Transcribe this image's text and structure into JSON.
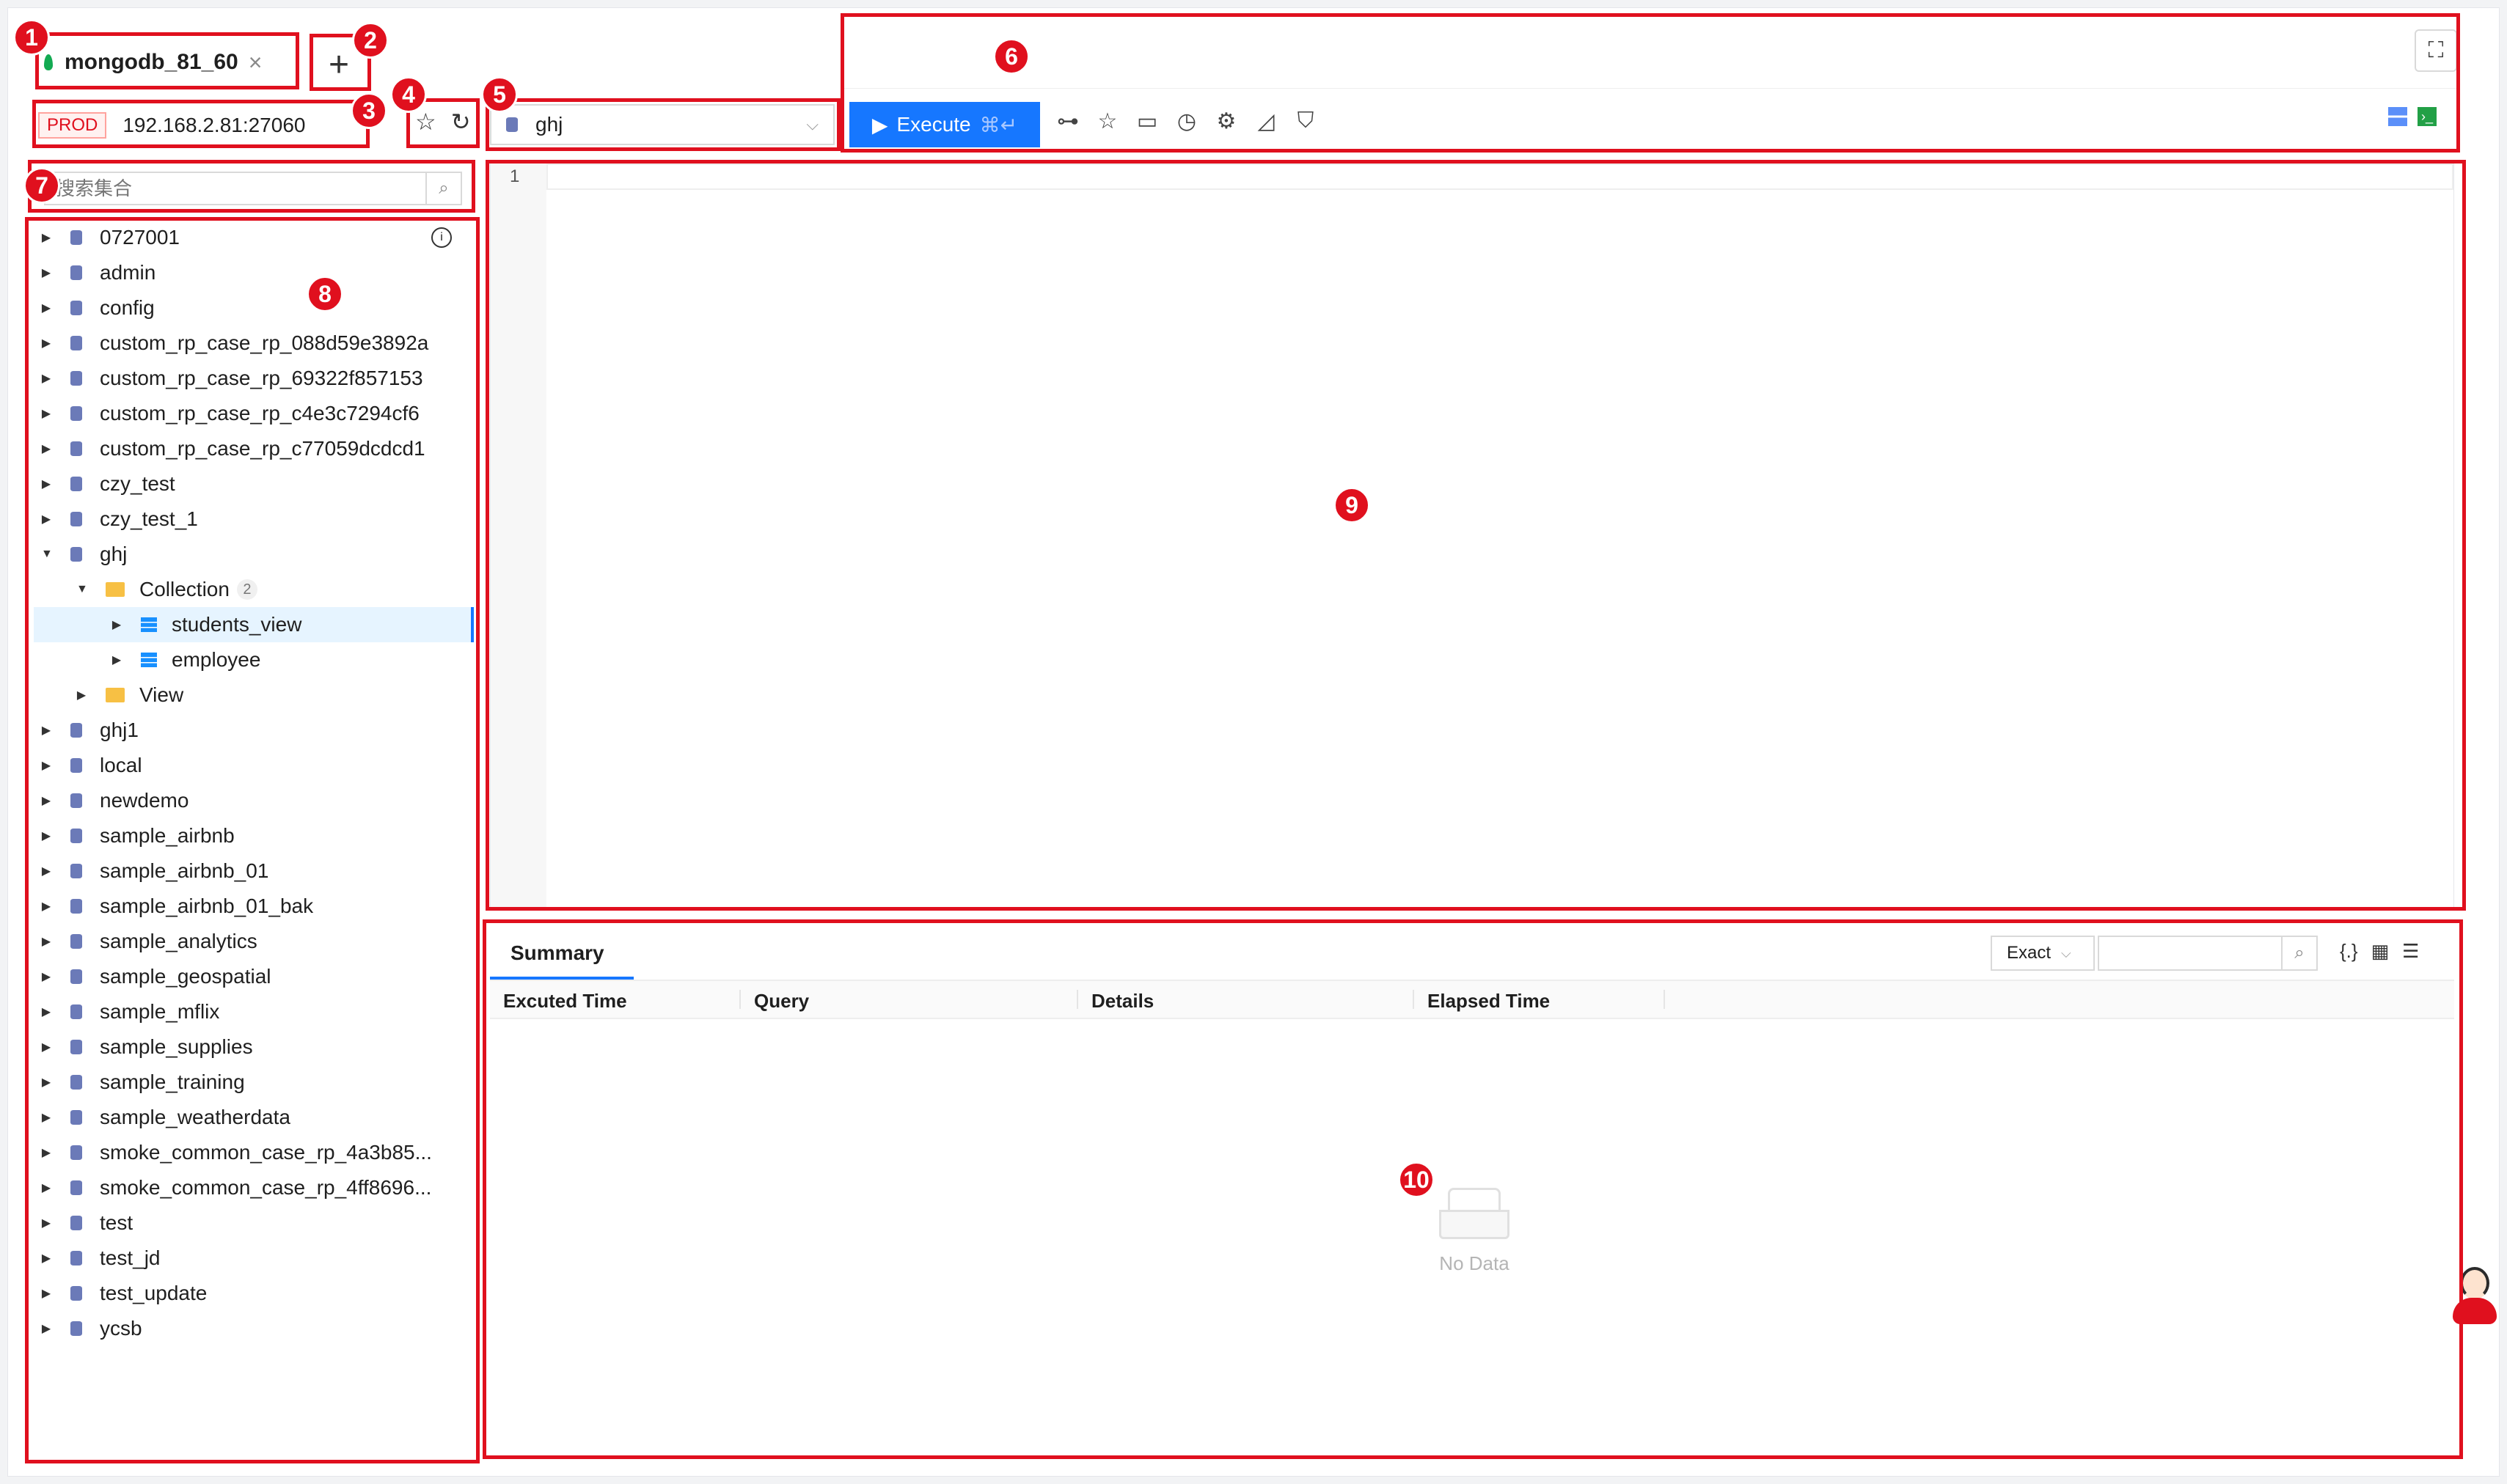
{
  "tab": {
    "label": "mongodb_81_60",
    "close": "×",
    "add": "+"
  },
  "connection": {
    "env": "PROD",
    "address": "192.168.2.81:27060"
  },
  "actions": {
    "star": "☆",
    "refresh": "↻"
  },
  "db_select": {
    "value": "ghj",
    "chevron": "⌵"
  },
  "toolbar": {
    "execute_label": "Execute",
    "execute_shortcut": "⌘↵",
    "fullscreen": "⛶",
    "icons": [
      "schema-icon",
      "favorite-icon",
      "folder-icon",
      "history-icon",
      "settings-icon",
      "chart-icon",
      "shield-icon"
    ]
  },
  "sidebar": {
    "search_placeholder": "搜索集合",
    "tree": [
      {
        "label": "0727001",
        "type": "db",
        "depth": 0,
        "expanded": false,
        "info": true
      },
      {
        "label": "admin",
        "type": "db",
        "depth": 0,
        "expanded": false
      },
      {
        "label": "config",
        "type": "db",
        "depth": 0,
        "expanded": false
      },
      {
        "label": "custom_rp_case_rp_088d59e3892a",
        "type": "db",
        "depth": 0,
        "expanded": false
      },
      {
        "label": "custom_rp_case_rp_69322f857153",
        "type": "db",
        "depth": 0,
        "expanded": false
      },
      {
        "label": "custom_rp_case_rp_c4e3c7294cf6",
        "type": "db",
        "depth": 0,
        "expanded": false
      },
      {
        "label": "custom_rp_case_rp_c77059dcdcd1",
        "type": "db",
        "depth": 0,
        "expanded": false
      },
      {
        "label": "czy_test",
        "type": "db",
        "depth": 0,
        "expanded": false
      },
      {
        "label": "czy_test_1",
        "type": "db",
        "depth": 0,
        "expanded": false
      },
      {
        "label": "ghj",
        "type": "db",
        "depth": 0,
        "expanded": true
      },
      {
        "label": "Collection",
        "type": "folder",
        "depth": 1,
        "expanded": true,
        "count": "2"
      },
      {
        "label": "students_view",
        "type": "collection",
        "depth": 2,
        "expanded": false,
        "selected": true
      },
      {
        "label": "employee",
        "type": "collection",
        "depth": 2,
        "expanded": false
      },
      {
        "label": "View",
        "type": "folder",
        "depth": 1,
        "expanded": false
      },
      {
        "label": "ghj1",
        "type": "db",
        "depth": 0,
        "expanded": false
      },
      {
        "label": "local",
        "type": "db",
        "depth": 0,
        "expanded": false
      },
      {
        "label": "newdemo",
        "type": "db",
        "depth": 0,
        "expanded": false
      },
      {
        "label": "sample_airbnb",
        "type": "db",
        "depth": 0,
        "expanded": false
      },
      {
        "label": "sample_airbnb_01",
        "type": "db",
        "depth": 0,
        "expanded": false
      },
      {
        "label": "sample_airbnb_01_bak",
        "type": "db",
        "depth": 0,
        "expanded": false
      },
      {
        "label": "sample_analytics",
        "type": "db",
        "depth": 0,
        "expanded": false
      },
      {
        "label": "sample_geospatial",
        "type": "db",
        "depth": 0,
        "expanded": false
      },
      {
        "label": "sample_mflix",
        "type": "db",
        "depth": 0,
        "expanded": false
      },
      {
        "label": "sample_supplies",
        "type": "db",
        "depth": 0,
        "expanded": false
      },
      {
        "label": "sample_training",
        "type": "db",
        "depth": 0,
        "expanded": false
      },
      {
        "label": "sample_weatherdata",
        "type": "db",
        "depth": 0,
        "expanded": false
      },
      {
        "label": "smoke_common_case_rp_4a3b85...",
        "type": "db",
        "depth": 0,
        "expanded": false
      },
      {
        "label": "smoke_common_case_rp_4ff8696...",
        "type": "db",
        "depth": 0,
        "expanded": false
      },
      {
        "label": "test",
        "type": "db",
        "depth": 0,
        "expanded": false
      },
      {
        "label": "test_jd",
        "type": "db",
        "depth": 0,
        "expanded": false
      },
      {
        "label": "test_update",
        "type": "db",
        "depth": 0,
        "expanded": false
      },
      {
        "label": "ycsb",
        "type": "db",
        "depth": 0,
        "expanded": false
      }
    ]
  },
  "editor": {
    "line_number": "1"
  },
  "results": {
    "tab_label": "Summary",
    "match_mode": "Exact",
    "columns": [
      "Excuted Time",
      "Query",
      "Details",
      "Elapsed Time"
    ],
    "empty_text": "No Data",
    "view_icons": [
      "{.}",
      "▦",
      "☰"
    ]
  },
  "annotations": [
    "1",
    "2",
    "3",
    "4",
    "5",
    "6",
    "7",
    "8",
    "9",
    "10"
  ],
  "colors": {
    "accent": "#1677ff",
    "highlight": "#e0101e",
    "env_tag": "#e0101e"
  }
}
